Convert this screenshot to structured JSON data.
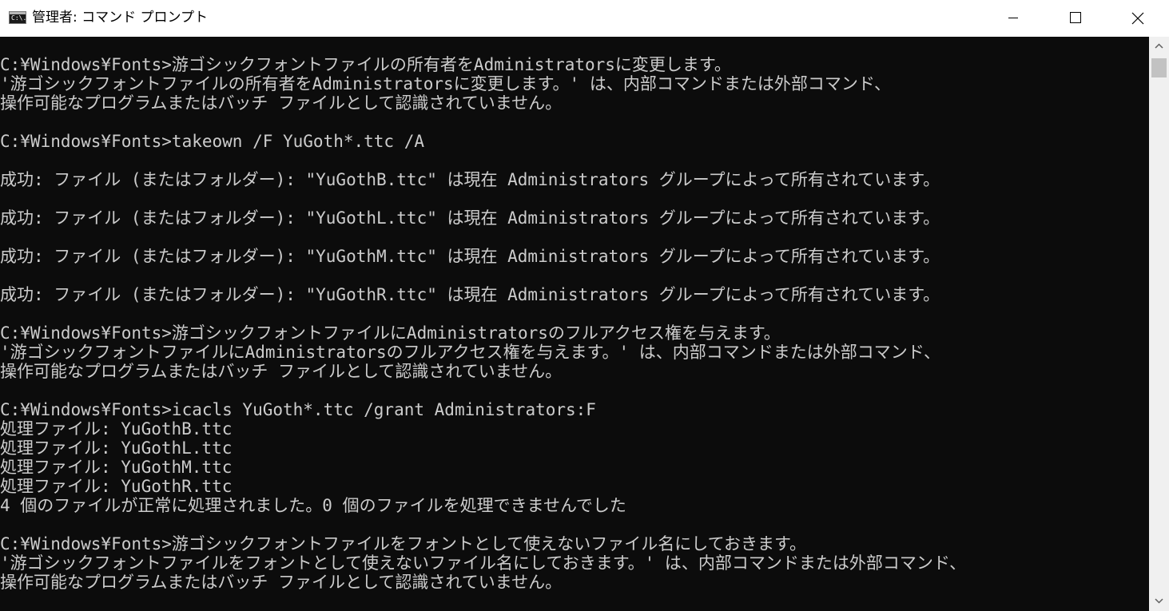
{
  "window": {
    "title": "管理者: コマンド プロンプト",
    "icon": "cmd-icon",
    "icon_glyph": "C:\\."
  },
  "titlebar_buttons": {
    "minimize": "minimize-icon",
    "maximize": "maximize-icon",
    "close": "close-icon"
  },
  "console": {
    "background_color": "#0c0c0c",
    "text_color": "#cccccc",
    "lines": [
      "C:¥Windows¥Fonts>游ゴシックフォントファイルの所有者をAdministratorsに変更します。",
      "'游ゴシックフォントファイルの所有者をAdministratorsに変更します。' は、内部コマンドまたは外部コマンド、",
      "操作可能なプログラムまたはバッチ ファイルとして認識されていません。",
      "",
      "C:¥Windows¥Fonts>takeown /F YuGoth*.ttc /A",
      "",
      "成功: ファイル (またはフォルダー): \"YuGothB.ttc\" は現在 Administrators グループによって所有されています。",
      "",
      "成功: ファイル (またはフォルダー): \"YuGothL.ttc\" は現在 Administrators グループによって所有されています。",
      "",
      "成功: ファイル (またはフォルダー): \"YuGothM.ttc\" は現在 Administrators グループによって所有されています。",
      "",
      "成功: ファイル (またはフォルダー): \"YuGothR.ttc\" は現在 Administrators グループによって所有されています。",
      "",
      "C:¥Windows¥Fonts>游ゴシックフォントファイルにAdministratorsのフルアクセス権を与えます。",
      "'游ゴシックフォントファイルにAdministratorsのフルアクセス権を与えます。' は、内部コマンドまたは外部コマンド、",
      "操作可能なプログラムまたはバッチ ファイルとして認識されていません。",
      "",
      "C:¥Windows¥Fonts>icacls YuGoth*.ttc /grant Administrators:F",
      "処理ファイル: YuGothB.ttc",
      "処理ファイル: YuGothL.ttc",
      "処理ファイル: YuGothM.ttc",
      "処理ファイル: YuGothR.ttc",
      "4 個のファイルが正常に処理されました。0 個のファイルを処理できませんでした",
      "",
      "C:¥Windows¥Fonts>游ゴシックフォントファイルをフォントとして使えないファイル名にしておきます。",
      "'游ゴシックフォントファイルをフォントとして使えないファイル名にしておきます。' は、内部コマンドまたは外部コマンド、",
      "操作可能なプログラムまたはバッチ ファイルとして認識されていません。"
    ]
  },
  "scrollbar": {
    "up_arrow": "scroll-up-icon",
    "down_arrow": "scroll-down-icon",
    "position": 0
  }
}
